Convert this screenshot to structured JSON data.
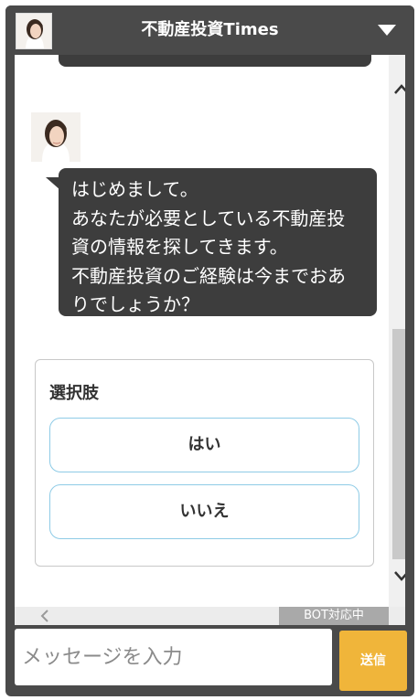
{
  "header": {
    "title": "不動産投資Times",
    "avatar_icon": "woman-portrait-icon",
    "collapse_icon": "triangle-down-icon"
  },
  "chat": {
    "bot_avatar_icon": "woman-portrait-icon",
    "message_lines": [
      "はじめまして。",
      "あなたが必要としている不動産投",
      "資の情報を探してきます。",
      "不動産投資のご経験は今までおあ",
      "りでしょうか？"
    ],
    "choices": {
      "label": "選択肢",
      "options": [
        "はい",
        "いいえ"
      ]
    },
    "scroll_up_icon": "chevron-up-icon",
    "scroll_down_icon": "chevron-down-icon"
  },
  "footer": {
    "left_icon": "chevron-left-icon",
    "bot_badge": "BOT対応中"
  },
  "composer": {
    "placeholder": "メッセージを入力",
    "send_label": "送信"
  },
  "colors": {
    "header_bg": "#4a4a4a",
    "bubble_bg": "#3d3d3d",
    "choice_border": "#8ecbe6",
    "send_bg": "#f0b53a"
  }
}
